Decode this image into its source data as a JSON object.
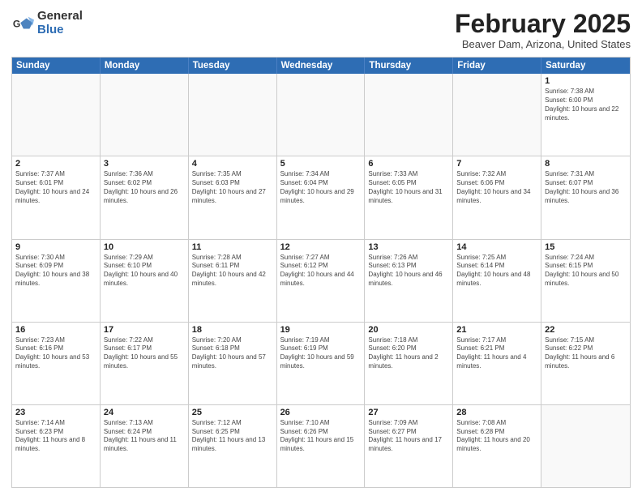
{
  "logo": {
    "general": "General",
    "blue": "Blue"
  },
  "title": {
    "main": "February 2025",
    "sub": "Beaver Dam, Arizona, United States"
  },
  "calendar": {
    "headers": [
      "Sunday",
      "Monday",
      "Tuesday",
      "Wednesday",
      "Thursday",
      "Friday",
      "Saturday"
    ],
    "rows": [
      [
        {
          "day": "",
          "info": ""
        },
        {
          "day": "",
          "info": ""
        },
        {
          "day": "",
          "info": ""
        },
        {
          "day": "",
          "info": ""
        },
        {
          "day": "",
          "info": ""
        },
        {
          "day": "",
          "info": ""
        },
        {
          "day": "1",
          "info": "Sunrise: 7:38 AM\nSunset: 6:00 PM\nDaylight: 10 hours and 22 minutes."
        }
      ],
      [
        {
          "day": "2",
          "info": "Sunrise: 7:37 AM\nSunset: 6:01 PM\nDaylight: 10 hours and 24 minutes."
        },
        {
          "day": "3",
          "info": "Sunrise: 7:36 AM\nSunset: 6:02 PM\nDaylight: 10 hours and 26 minutes."
        },
        {
          "day": "4",
          "info": "Sunrise: 7:35 AM\nSunset: 6:03 PM\nDaylight: 10 hours and 27 minutes."
        },
        {
          "day": "5",
          "info": "Sunrise: 7:34 AM\nSunset: 6:04 PM\nDaylight: 10 hours and 29 minutes."
        },
        {
          "day": "6",
          "info": "Sunrise: 7:33 AM\nSunset: 6:05 PM\nDaylight: 10 hours and 31 minutes."
        },
        {
          "day": "7",
          "info": "Sunrise: 7:32 AM\nSunset: 6:06 PM\nDaylight: 10 hours and 34 minutes."
        },
        {
          "day": "8",
          "info": "Sunrise: 7:31 AM\nSunset: 6:07 PM\nDaylight: 10 hours and 36 minutes."
        }
      ],
      [
        {
          "day": "9",
          "info": "Sunrise: 7:30 AM\nSunset: 6:09 PM\nDaylight: 10 hours and 38 minutes."
        },
        {
          "day": "10",
          "info": "Sunrise: 7:29 AM\nSunset: 6:10 PM\nDaylight: 10 hours and 40 minutes."
        },
        {
          "day": "11",
          "info": "Sunrise: 7:28 AM\nSunset: 6:11 PM\nDaylight: 10 hours and 42 minutes."
        },
        {
          "day": "12",
          "info": "Sunrise: 7:27 AM\nSunset: 6:12 PM\nDaylight: 10 hours and 44 minutes."
        },
        {
          "day": "13",
          "info": "Sunrise: 7:26 AM\nSunset: 6:13 PM\nDaylight: 10 hours and 46 minutes."
        },
        {
          "day": "14",
          "info": "Sunrise: 7:25 AM\nSunset: 6:14 PM\nDaylight: 10 hours and 48 minutes."
        },
        {
          "day": "15",
          "info": "Sunrise: 7:24 AM\nSunset: 6:15 PM\nDaylight: 10 hours and 50 minutes."
        }
      ],
      [
        {
          "day": "16",
          "info": "Sunrise: 7:23 AM\nSunset: 6:16 PM\nDaylight: 10 hours and 53 minutes."
        },
        {
          "day": "17",
          "info": "Sunrise: 7:22 AM\nSunset: 6:17 PM\nDaylight: 10 hours and 55 minutes."
        },
        {
          "day": "18",
          "info": "Sunrise: 7:20 AM\nSunset: 6:18 PM\nDaylight: 10 hours and 57 minutes."
        },
        {
          "day": "19",
          "info": "Sunrise: 7:19 AM\nSunset: 6:19 PM\nDaylight: 10 hours and 59 minutes."
        },
        {
          "day": "20",
          "info": "Sunrise: 7:18 AM\nSunset: 6:20 PM\nDaylight: 11 hours and 2 minutes."
        },
        {
          "day": "21",
          "info": "Sunrise: 7:17 AM\nSunset: 6:21 PM\nDaylight: 11 hours and 4 minutes."
        },
        {
          "day": "22",
          "info": "Sunrise: 7:15 AM\nSunset: 6:22 PM\nDaylight: 11 hours and 6 minutes."
        }
      ],
      [
        {
          "day": "23",
          "info": "Sunrise: 7:14 AM\nSunset: 6:23 PM\nDaylight: 11 hours and 8 minutes."
        },
        {
          "day": "24",
          "info": "Sunrise: 7:13 AM\nSunset: 6:24 PM\nDaylight: 11 hours and 11 minutes."
        },
        {
          "day": "25",
          "info": "Sunrise: 7:12 AM\nSunset: 6:25 PM\nDaylight: 11 hours and 13 minutes."
        },
        {
          "day": "26",
          "info": "Sunrise: 7:10 AM\nSunset: 6:26 PM\nDaylight: 11 hours and 15 minutes."
        },
        {
          "day": "27",
          "info": "Sunrise: 7:09 AM\nSunset: 6:27 PM\nDaylight: 11 hours and 17 minutes."
        },
        {
          "day": "28",
          "info": "Sunrise: 7:08 AM\nSunset: 6:28 PM\nDaylight: 11 hours and 20 minutes."
        },
        {
          "day": "",
          "info": ""
        }
      ]
    ]
  }
}
